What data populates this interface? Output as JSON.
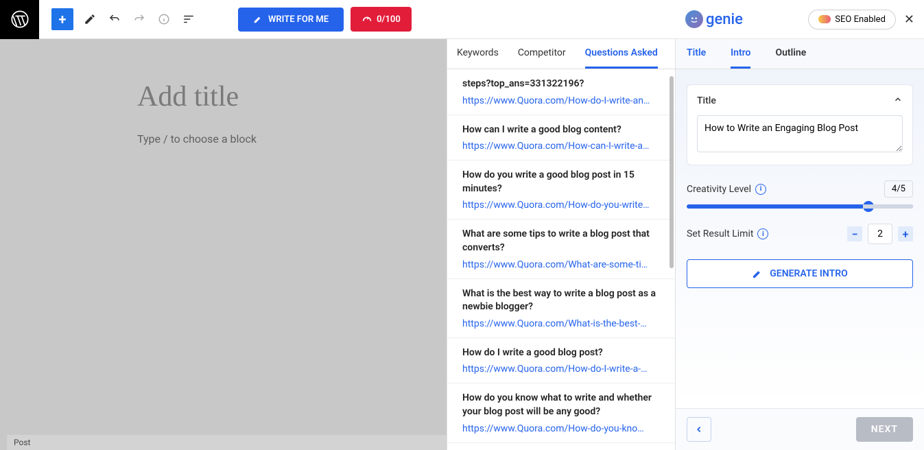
{
  "toolbar": {
    "write_label": "WRITE FOR ME",
    "score": "0/100"
  },
  "editor": {
    "title_placeholder": "Add title",
    "body_placeholder": "Type / to choose a block",
    "footer_status": "Post"
  },
  "mid": {
    "tabs": [
      "Keywords",
      "Competitor",
      "Questions Asked"
    ],
    "active_tab": 2,
    "questions": [
      {
        "q": "steps?top_ans=331322196?",
        "url": "https://www.Quora.com/How-do-I-write-an…"
      },
      {
        "q": "How can I write a good blog content?",
        "url": "https://www.Quora.com/How-can-I-write-a…"
      },
      {
        "q": "How do you write a good blog post in 15 minutes?",
        "url": "https://www.Quora.com/How-do-you-write…"
      },
      {
        "q": "What are some tips to write a blog post that converts?",
        "url": "https://www.Quora.com/What-are-some-ti…"
      },
      {
        "q": "What is the best way to write a blog post as a newbie blogger?",
        "url": "https://www.Quora.com/What-is-the-best-…"
      },
      {
        "q": "How do I write a good blog post?",
        "url": "https://www.Quora.com/How-do-I-write-a-…"
      },
      {
        "q": "How do you know what to write and whether your blog post will be any good?",
        "url": "https://www.Quora.com/How-do-you-kno…"
      }
    ]
  },
  "right": {
    "brand": "genie",
    "seo_label": "SEO Enabled",
    "tabs": [
      "Title",
      "Intro",
      "Outline"
    ],
    "title_card": {
      "label": "Title",
      "value": "How to Write an Engaging Blog Post"
    },
    "creativity": {
      "label": "Creativity Level",
      "value": "4/5"
    },
    "limit": {
      "label": "Set Result Limit",
      "value": "2"
    },
    "generate_label": "GENERATE INTRO",
    "next_label": "NEXT"
  }
}
